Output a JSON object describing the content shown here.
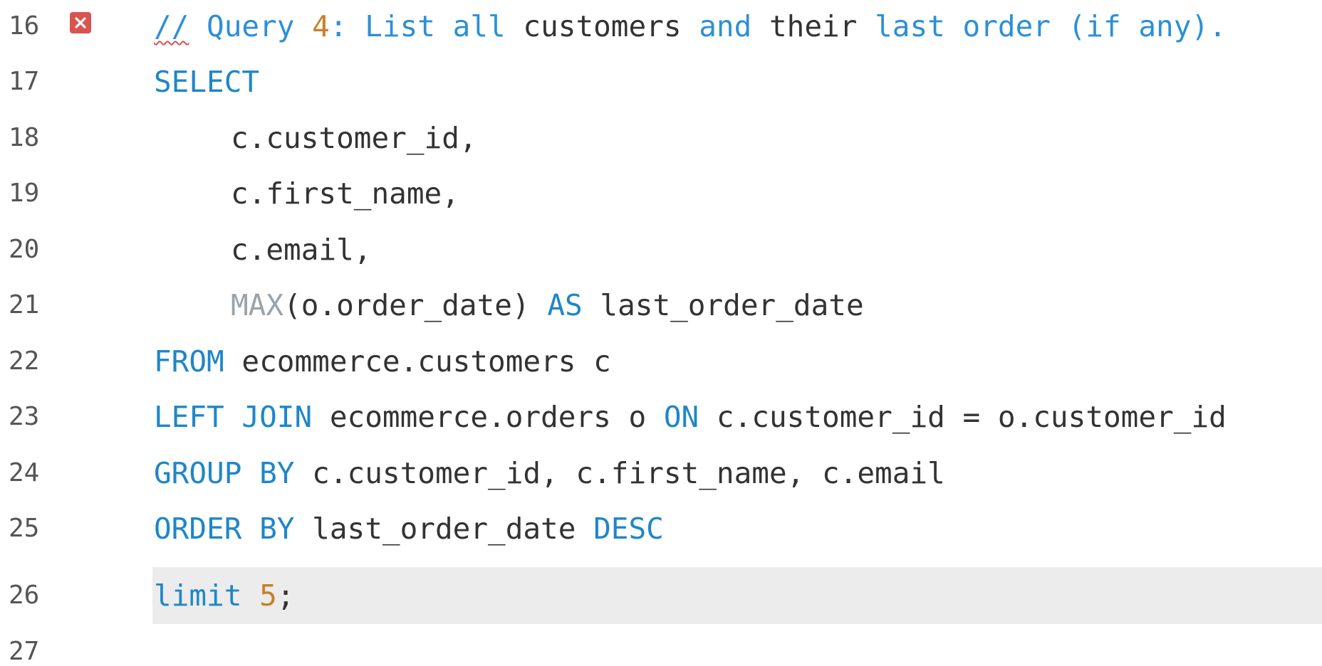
{
  "editor": {
    "accent_colors": {
      "keyword": "#1f86c8",
      "function": "#9aa3aa",
      "number": "#c8802a",
      "comment": "#2d8fd6",
      "error": "#d9534f",
      "current_line_bg": "#ececec"
    },
    "current_line": 26,
    "error_marker_line": 16,
    "lines": [
      {
        "number": "16",
        "tokens": {
          "t0": "//",
          "t1": " Query ",
          "t2": "4",
          "t3": ": List all ",
          "t4": "customers",
          "t5": " and ",
          "t6": "their",
          "t7": " last order (if any)."
        }
      },
      {
        "number": "17",
        "tokens": {
          "t0": "SELECT"
        }
      },
      {
        "number": "18",
        "tokens": {
          "t0": "c.customer_id,"
        }
      },
      {
        "number": "19",
        "tokens": {
          "t0": "c.first_name,"
        }
      },
      {
        "number": "20",
        "tokens": {
          "t0": "c.email,"
        }
      },
      {
        "number": "21",
        "tokens": {
          "t0": "MAX",
          "t1": "(o.order_date) ",
          "t2": "AS",
          "t3": " last_order_date"
        }
      },
      {
        "number": "22",
        "tokens": {
          "t0": "FROM",
          "t1": " ecommerce.customers c"
        }
      },
      {
        "number": "23",
        "tokens": {
          "t0": "LEFT JOIN",
          "t1": " ecommerce.orders o ",
          "t2": "ON",
          "t3": " c.customer_id = o.customer_id"
        }
      },
      {
        "number": "24",
        "tokens": {
          "t0": "GROUP BY",
          "t1": " c.customer_id, c.first_name, c.email"
        }
      },
      {
        "number": "25",
        "tokens": {
          "t0": "ORDER BY",
          "t1": " last_order_date ",
          "t2": "DESC"
        }
      },
      {
        "number": "26",
        "tokens": {
          "t0": "limit",
          "t1": " ",
          "t2": "5",
          "t3": ";"
        }
      },
      {
        "number": "27",
        "tokens": {}
      }
    ],
    "icons": {
      "error_marker": "error-x-icon"
    }
  }
}
